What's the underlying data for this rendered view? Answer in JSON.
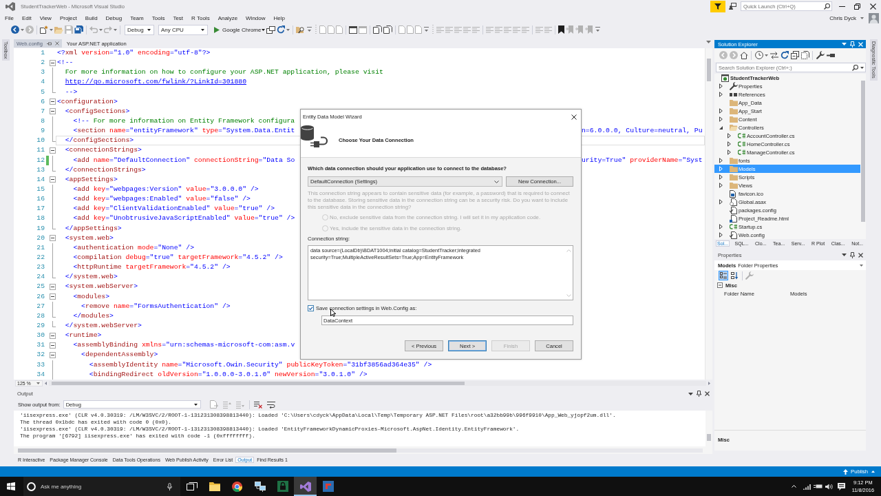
{
  "title_bar": {
    "title": "StudentTrackerWeb - Microsoft Visual Studio",
    "quick_launch": {
      "placeholder": "Quick Launch (Ctrl+Q)"
    }
  },
  "menu": [
    "File",
    "Edit",
    "View",
    "Project",
    "Build",
    "Debug",
    "Team",
    "Tools",
    "Test",
    "R Tools",
    "Analyze",
    "Window",
    "Help"
  ],
  "account": {
    "name": "Chris Dyck"
  },
  "toolbar": [
    {
      "kind": "back",
      "disabled": false
    },
    {
      "kind": "forward",
      "disabled": true
    },
    {
      "kind": "separator"
    },
    {
      "kind": "new-item",
      "disabled": false
    },
    {
      "kind": "open",
      "disabled": false
    },
    {
      "kind": "save",
      "disabled": true
    },
    {
      "kind": "save-all",
      "disabled": false
    },
    {
      "kind": "separator"
    },
    {
      "kind": "undo",
      "disabled": true
    },
    {
      "kind": "redo",
      "disabled": true
    },
    {
      "kind": "separator"
    },
    {
      "kind": "dropdown",
      "value": "Debug"
    },
    {
      "kind": "dropdown",
      "value": "Any CPU"
    },
    {
      "kind": "run",
      "label": "Google Chrome"
    },
    {
      "kind": "browser-link",
      "disabled": false
    },
    {
      "kind": "refresh",
      "disabled": false
    },
    {
      "kind": "separator"
    },
    {
      "kind": "find",
      "disabled": false
    },
    {
      "kind": "overflow"
    },
    {
      "kind": "grip"
    },
    {
      "kind": "page",
      "disabled": true
    },
    {
      "kind": "page",
      "disabled": true
    },
    {
      "kind": "page",
      "disabled": true
    },
    {
      "kind": "separator"
    },
    {
      "kind": "window",
      "disabled": false
    },
    {
      "kind": "window",
      "disabled": true
    },
    {
      "kind": "separator"
    },
    {
      "kind": "page-pair",
      "disabled": false
    },
    {
      "kind": "page-pair",
      "disabled": false
    },
    {
      "kind": "separator"
    },
    {
      "kind": "page",
      "disabled": true
    },
    {
      "kind": "page",
      "disabled": true
    },
    {
      "kind": "page",
      "disabled": true
    },
    {
      "kind": "overflow"
    },
    {
      "kind": "grip"
    },
    {
      "kind": "lines",
      "disabled": true
    },
    {
      "kind": "lines",
      "disabled": true
    },
    {
      "kind": "lines",
      "disabled": true
    },
    {
      "kind": "lines",
      "disabled": true
    },
    {
      "kind": "lines",
      "disabled": true
    },
    {
      "kind": "separator"
    },
    {
      "kind": "lines",
      "disabled": true
    },
    {
      "kind": "lines",
      "disabled": true
    },
    {
      "kind": "lines",
      "disabled": true
    },
    {
      "kind": "lines",
      "disabled": true
    },
    {
      "kind": "lines",
      "disabled": true
    },
    {
      "kind": "separator"
    },
    {
      "kind": "lines",
      "disabled": true
    },
    {
      "kind": "lines",
      "disabled": true
    },
    {
      "kind": "separator"
    },
    {
      "kind": "bookmark",
      "disabled": false
    },
    {
      "kind": "bookmark-arrow",
      "disabled": true
    },
    {
      "kind": "bookmark-arrow",
      "disabled": true
    },
    {
      "kind": "bookmark-arrow",
      "disabled": true
    },
    {
      "kind": "overflow"
    }
  ],
  "toolbox_tab": {
    "label": "Toolbox"
  },
  "document_tabs": [
    {
      "label": "Web.config",
      "selected": true
    },
    {
      "label": "Your ASP.NET application",
      "selected": false
    }
  ],
  "editor": {
    "lines": [
      {
        "number": "1",
        "text": "<?xml version=\"1.0\" encoding=\"utf-8\"?>",
        "kind": "plain",
        "changed": false,
        "current": false
      },
      {
        "number": "2",
        "text": "<!--",
        "kind": "fold-start",
        "changed": false,
        "current": false
      },
      {
        "number": "3",
        "text": "  For more information on how to configure your ASP.NET application, please visit",
        "kind": "fold-inside",
        "changed": false,
        "current": false
      },
      {
        "number": "4",
        "text": "  http://go.microsoft.com/fwlink/?LinkId=301880",
        "kind": "fold-inside",
        "changed": false,
        "current": false
      },
      {
        "number": "5",
        "text": "  -->",
        "kind": "fold-end",
        "changed": false,
        "current": false
      },
      {
        "number": "6",
        "text": "<configuration>",
        "kind": "fold-start",
        "changed": false,
        "current": false
      },
      {
        "number": "7",
        "text": "  <configSections>",
        "kind": "fold-start",
        "changed": false,
        "current": false
      },
      {
        "number": "8",
        "text": "    <!-- For more information on Entity Framework configura",
        "kind": "fold-inside",
        "changed": false,
        "current": false
      },
      {
        "number": "9",
        "text": "    <section name=\"entityFramework\" type=\"System.Data.Entit",
        "after_dialog": "n=6.0.0.0, Culture=neutral, Pu",
        "kind": "fold-inside",
        "changed": false,
        "current": false
      },
      {
        "number": "10",
        "text": "  </configSections>",
        "kind": "fold-end",
        "changed": false,
        "current": true
      },
      {
        "number": "11",
        "text": "  <connectionStrings>",
        "kind": "fold-start",
        "changed": false,
        "current": false
      },
      {
        "number": "12",
        "text": "    <add name=\"DefaultConnection\" connectionString=\"Data So",
        "after_dialog": "urity=True\" providerName=\"Syst",
        "kind": "fold-inside",
        "changed": true,
        "current": false
      },
      {
        "number": "13",
        "text": "  </connectionStrings>",
        "kind": "fold-end",
        "changed": false,
        "current": false
      },
      {
        "number": "14",
        "text": "  <appSettings>",
        "kind": "fold-start",
        "changed": false,
        "current": false
      },
      {
        "number": "15",
        "text": "    <add key=\"webpages:Version\" value=\"3.0.0.0\" />",
        "kind": "fold-inside",
        "changed": false,
        "current": false
      },
      {
        "number": "16",
        "text": "    <add key=\"webpages:Enabled\" value=\"false\" />",
        "kind": "fold-inside",
        "changed": false,
        "current": false
      },
      {
        "number": "17",
        "text": "    <add key=\"ClientValidationEnabled\" value=\"true\" />",
        "kind": "fold-inside",
        "changed": false,
        "current": false
      },
      {
        "number": "18",
        "text": "    <add key=\"UnobtrusiveJavaScriptEnabled\" value=\"true\" />",
        "kind": "fold-inside",
        "changed": false,
        "current": false
      },
      {
        "number": "19",
        "text": "  </appSettings>",
        "kind": "fold-end",
        "changed": false,
        "current": false
      },
      {
        "number": "20",
        "text": "  <system.web>",
        "kind": "fold-start",
        "changed": false,
        "current": false
      },
      {
        "number": "21",
        "text": "    <authentication mode=\"None\" />",
        "kind": "fold-inside",
        "changed": false,
        "current": false
      },
      {
        "number": "22",
        "text": "    <compilation debug=\"true\" targetFramework=\"4.5.2\" />",
        "kind": "fold-inside",
        "changed": false,
        "current": false
      },
      {
        "number": "23",
        "text": "    <httpRuntime targetFramework=\"4.5.2\" />",
        "kind": "fold-inside",
        "changed": false,
        "current": false
      },
      {
        "number": "24",
        "text": "  </system.web>",
        "kind": "fold-end",
        "changed": false,
        "current": false
      },
      {
        "number": "25",
        "text": "  <system.webServer>",
        "kind": "fold-start",
        "changed": false,
        "current": false
      },
      {
        "number": "26",
        "text": "    <modules>",
        "kind": "fold-start",
        "changed": false,
        "current": false
      },
      {
        "number": "27",
        "text": "      <remove name=\"FormsAuthentication\" />",
        "kind": "fold-inside",
        "changed": false,
        "current": false
      },
      {
        "number": "28",
        "text": "    </modules>",
        "kind": "fold-end",
        "changed": false,
        "current": false
      },
      {
        "number": "29",
        "text": "  </system.webServer>",
        "kind": "fold-end",
        "changed": false,
        "current": false
      },
      {
        "number": "30",
        "text": "  <runtime>",
        "kind": "fold-start",
        "changed": false,
        "current": false
      },
      {
        "number": "31",
        "text": "    <assemblyBinding xmlns=\"urn:schemas-microsoft-com:asm.v",
        "kind": "fold-start",
        "changed": false,
        "current": false
      },
      {
        "number": "32",
        "text": "      <dependentAssembly>",
        "kind": "fold-start",
        "changed": false,
        "current": false
      },
      {
        "number": "33",
        "text": "        <assemblyIdentity name=\"Microsoft.Owin.Security\" publicKeyToken=\"31bf3856ad364e35\" />",
        "kind": "fold-inside",
        "changed": false,
        "current": false
      },
      {
        "number": "34",
        "text": "        <bindingRedirect oldVersion=\"1.0.0.0-3.0.1.0\" newVersion=\"3.0.1.0\" />",
        "kind": "fold-inside",
        "changed": false,
        "current": false
      }
    ],
    "zoom": "125 %"
  },
  "dialog": {
    "title": "Entity Data Model Wizard",
    "heading": "Choose Your Data Connection",
    "question": "Which data connection should your application use to connect to the database?",
    "connection": {
      "value": "DefaultConnection (Settings)"
    },
    "new_connection_button": "New Connection...",
    "sensitive_note": {
      "text": "This connection string appears to contain sensitive data (for example, a password) that is required to connect to the database. Storing sensitive data in the connection string can be a security risk. Do you want to include this sensitive data in the connection string?",
      "disabled": true
    },
    "sensitive_options": [
      {
        "label": "No, exclude sensitive data from the connection string. I will set it in my application code.",
        "selected": false,
        "disabled": true
      },
      {
        "label": "Yes, include the sensitive data in the connection string.",
        "selected": false,
        "disabled": true
      }
    ],
    "connection_string_label": "Connection string:",
    "connection_string": "data source=(LocalDb)\\BDAT1004;initial catalog=StudentTracker;integrated security=True;MultipleActiveResultSets=True;App=EntityFramework",
    "save_setting": {
      "label": "Save connection settings in Web.Config as:",
      "checked": true
    },
    "entity_name": {
      "value": "DataContext"
    },
    "buttons": [
      {
        "label": "< Previous",
        "disabled": false,
        "focused": false
      },
      {
        "label": "Next >",
        "disabled": false,
        "focused": true
      },
      {
        "label": "Finish",
        "disabled": true,
        "focused": false
      },
      {
        "label": "Cancel",
        "disabled": false,
        "focused": false
      }
    ]
  },
  "output": {
    "title": "Output",
    "source_label": "Show output from:",
    "source": "Debug",
    "toolbar": [
      {
        "kind": "goto",
        "disabled": true
      },
      {
        "kind": "previous",
        "disabled": true
      },
      {
        "kind": "next",
        "disabled": true
      },
      {
        "kind": "separator"
      },
      {
        "kind": "clear",
        "disabled": false
      },
      {
        "kind": "wrap",
        "disabled": false
      }
    ],
    "lines": [
      "'iisexpress.exe' (CLR v4.0.30319: /LM/W3SVC/2/ROOT-1-131231308398813440): Loaded 'C:\\Users\\cdyck\\AppData\\Local\\Temp\\Temporary ASP.NET Files\\root\\a32bb99b\\996f9910\\App_Web_yjopf2um.dll'.",
      "The thread 0x1bdc has exited with code 0 (0x0).",
      "'iisexpress.exe' (CLR v4.0.30319: /LM/W3SVC/2/ROOT-1-131231308398813440): Loaded 'EntityFrameworkDynamicProxies-Microsoft.AspNet.Identity.EntityFramework'.",
      "The program '[6792] iisexpress.exe' has exited with code -1 (0xffffffff)."
    ]
  },
  "tool_tabs": [
    {
      "label": "R Interactive",
      "selected": false
    },
    {
      "label": "Package Manager Console",
      "selected": false
    },
    {
      "label": "Data Tools Operations",
      "selected": false
    },
    {
      "label": "Web Publish Activity",
      "selected": false
    },
    {
      "label": "Error List",
      "selected": false
    },
    {
      "label": "Output",
      "selected": true
    },
    {
      "label": "Find Results 1",
      "selected": false
    }
  ],
  "solution_explorer": {
    "title": "Solution Explorer",
    "toolbar": [
      {
        "kind": "back",
        "disabled": true
      },
      {
        "kind": "forward",
        "disabled": true
      },
      {
        "kind": "home",
        "disabled": false
      },
      {
        "kind": "separator"
      },
      {
        "kind": "history",
        "disabled": false
      },
      {
        "kind": "sync",
        "disabled": false
      },
      {
        "kind": "refresh",
        "disabled": false
      },
      {
        "kind": "collapse",
        "disabled": false
      },
      {
        "kind": "show-all",
        "disabled": false
      },
      {
        "kind": "separator"
      },
      {
        "kind": "properties",
        "disabled": false
      },
      {
        "kind": "preview",
        "disabled": false
      }
    ],
    "search": {
      "placeholder": "Search Solution Explorer (Ctrl+;)"
    },
    "tree": [
      {
        "label": "StudentTrackerWeb",
        "kind": "project",
        "selected": false,
        "children": [
          {
            "label": "Properties",
            "kind": "properties",
            "expanded": false,
            "selected": false
          },
          {
            "label": "References",
            "kind": "references",
            "expanded": false,
            "selected": false
          },
          {
            "label": "App_Data",
            "kind": "folder",
            "selected": false
          },
          {
            "label": "App_Start",
            "kind": "folder",
            "expanded": false,
            "selected": false
          },
          {
            "label": "Content",
            "kind": "folder",
            "expanded": false,
            "selected": false
          },
          {
            "label": "Controllers",
            "kind": "folder",
            "expanded": true,
            "selected": false,
            "children": [
              {
                "label": "AccountController.cs",
                "kind": "csharp",
                "expanded": false,
                "selected": false
              },
              {
                "label": "HomeController.cs",
                "kind": "csharp",
                "expanded": false,
                "selected": false
              },
              {
                "label": "ManageController.cs",
                "kind": "csharp",
                "expanded": false,
                "selected": false
              }
            ]
          },
          {
            "label": "fonts",
            "kind": "folder",
            "expanded": false,
            "selected": false
          },
          {
            "label": "Models",
            "kind": "folder",
            "expanded": false,
            "selected": true
          },
          {
            "label": "Scripts",
            "kind": "folder",
            "expanded": false,
            "selected": false
          },
          {
            "label": "Views",
            "kind": "folder",
            "expanded": false,
            "selected": false
          },
          {
            "label": "favicon.ico",
            "kind": "image",
            "selected": false
          },
          {
            "label": "Global.asax",
            "kind": "asax",
            "expanded": false,
            "selected": false
          },
          {
            "label": "packages.config",
            "kind": "config",
            "selected": false
          },
          {
            "label": "Project_Readme.html",
            "kind": "html",
            "selected": false
          },
          {
            "label": "Startup.cs",
            "kind": "csharp",
            "expanded": false,
            "selected": false
          },
          {
            "label": "Web.config",
            "kind": "config",
            "expanded": false,
            "selected": false
          }
        ]
      }
    ],
    "tabs": [
      {
        "label": "Sol...",
        "selected": true
      },
      {
        "label": "SQL...",
        "selected": false
      },
      {
        "label": "Clo...",
        "selected": false
      },
      {
        "label": "Tea...",
        "selected": false
      },
      {
        "label": "Serv...",
        "selected": false
      },
      {
        "label": "R Plot",
        "selected": false
      },
      {
        "label": "Clas...",
        "selected": false
      },
      {
        "label": "Not...",
        "selected": false
      }
    ]
  },
  "properties": {
    "title": "Properties",
    "object": {
      "name": "Models",
      "type": "Folder Properties"
    },
    "toolbar": [
      {
        "kind": "categorized",
        "selected": true,
        "disabled": false
      },
      {
        "kind": "alphabetical",
        "selected": false,
        "disabled": false
      },
      {
        "kind": "separator"
      },
      {
        "kind": "property-pages",
        "disabled": true
      }
    ],
    "categories": [
      {
        "name": "Misc",
        "expanded": true,
        "rows": [
          {
            "name": "Folder Name",
            "value": "Models"
          }
        ]
      }
    ],
    "description": {
      "title": "Misc"
    }
  },
  "diagnostic_tab": {
    "label": "Diagnostic Tools"
  },
  "status_bar": {
    "publish": "Publish"
  },
  "taskbar": {
    "search": {
      "placeholder": "Ask me anything"
    },
    "apps": [
      {
        "kind": "task-view",
        "active": false
      },
      {
        "kind": "file-explorer",
        "active": false
      },
      {
        "kind": "browser",
        "active": false
      },
      {
        "kind": "network",
        "active": false
      },
      {
        "kind": "security",
        "active": false
      },
      {
        "kind": "visual-studio",
        "active": true
      },
      {
        "kind": "remote",
        "active": false
      }
    ],
    "clock": {
      "time": "9:12 PM",
      "date": "11/8/2016"
    }
  }
}
